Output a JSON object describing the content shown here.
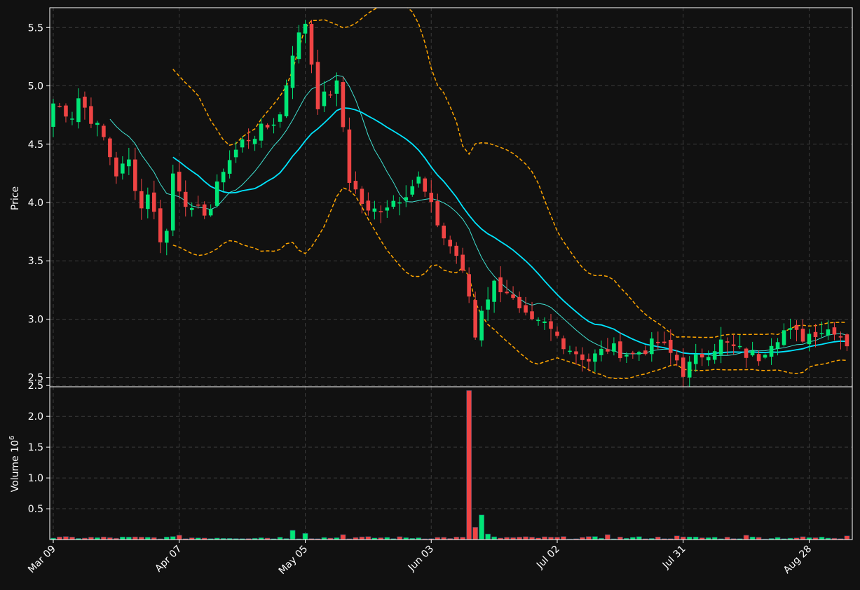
{
  "chart_data": {
    "type": "candlestick",
    "price_panel": {
      "ylabel": "Price",
      "ylim": [
        2.42,
        5.67
      ],
      "yticks": [
        2.5,
        3.0,
        3.5,
        4.0,
        4.5,
        5.0,
        5.5
      ],
      "ytick_labels": [
        "2.5",
        "3.0",
        "3.5",
        "4.0",
        "4.5",
        "5.0",
        "5.5"
      ]
    },
    "volume_panel": {
      "ylabel": "Volume",
      "ylabel_exponent": "10",
      "ylabel_exponent_power": "6",
      "ylim": [
        0,
        2.48
      ],
      "yticks": [
        0.5,
        1.0,
        1.5,
        2.0,
        2.5
      ],
      "ytick_labels": [
        "0.5",
        "1.0",
        "1.5",
        "2.0",
        "2.5"
      ]
    },
    "xticks": [
      {
        "label": "Mar 09",
        "index": 0
      },
      {
        "label": "Apr 07",
        "index": 20
      },
      {
        "label": "May 05",
        "index": 40
      },
      {
        "label": "Jun 03",
        "index": 60
      },
      {
        "label": "Jul 02",
        "index": 80
      },
      {
        "label": "Jul 31",
        "index": 100
      },
      {
        "label": "Aug 28",
        "index": 120
      }
    ],
    "n_bars": 127,
    "colors": {
      "up": "#00e676",
      "down": "#ef4444",
      "ma_fast": "#40e0d0",
      "ma_slow": "#00e5ff",
      "bands": "#ffa500",
      "grid": "#3a3a3a",
      "background": "#111111",
      "text": "#ffffff"
    },
    "price_anchors": [
      [
        0,
        4.85
      ],
      [
        3,
        4.75
      ],
      [
        4,
        4.9
      ],
      [
        8,
        4.55
      ],
      [
        10,
        4.25
      ],
      [
        12,
        4.35
      ],
      [
        14,
        3.95
      ],
      [
        15,
        4.1
      ],
      [
        17,
        3.7
      ],
      [
        18,
        3.75
      ],
      [
        19,
        4.25
      ],
      [
        22,
        3.9
      ],
      [
        25,
        3.95
      ],
      [
        27,
        4.3
      ],
      [
        30,
        4.52
      ],
      [
        34,
        4.65
      ],
      [
        36,
        4.75
      ],
      [
        38,
        5.3
      ],
      [
        40,
        5.55
      ],
      [
        42,
        4.85
      ],
      [
        45,
        5.0
      ],
      [
        46,
        4.65
      ],
      [
        47,
        4.2
      ],
      [
        48,
        4.1
      ],
      [
        50,
        3.9
      ],
      [
        55,
        4.05
      ],
      [
        58,
        4.2
      ],
      [
        60,
        3.95
      ],
      [
        62,
        3.7
      ],
      [
        64,
        3.55
      ],
      [
        66,
        3.2
      ],
      [
        67,
        2.85
      ],
      [
        68,
        3.1
      ],
      [
        70,
        3.3
      ],
      [
        72,
        3.25
      ],
      [
        74,
        3.05
      ],
      [
        76,
        2.95
      ],
      [
        78,
        2.95
      ],
      [
        80,
        2.85
      ],
      [
        82,
        2.75
      ],
      [
        85,
        2.65
      ],
      [
        88,
        2.75
      ],
      [
        92,
        2.7
      ],
      [
        96,
        2.8
      ],
      [
        99,
        2.65
      ],
      [
        100,
        2.55
      ],
      [
        103,
        2.7
      ],
      [
        106,
        2.8
      ],
      [
        110,
        2.7
      ],
      [
        112,
        2.68
      ],
      [
        114,
        2.82
      ],
      [
        116,
        2.9
      ],
      [
        119,
        2.85
      ],
      [
        121,
        2.9
      ],
      [
        124,
        2.92
      ],
      [
        126,
        2.8
      ]
    ],
    "volume_spikes": [
      [
        66,
        2.42
      ],
      [
        67,
        0.2
      ],
      [
        68,
        0.4
      ],
      [
        69,
        0.09
      ],
      [
        38,
        0.15
      ],
      [
        40,
        0.1
      ],
      [
        46,
        0.08
      ],
      [
        20,
        0.07
      ],
      [
        88,
        0.08
      ],
      [
        110,
        0.07
      ],
      [
        126,
        0.06
      ],
      [
        99,
        0.06
      ]
    ]
  }
}
